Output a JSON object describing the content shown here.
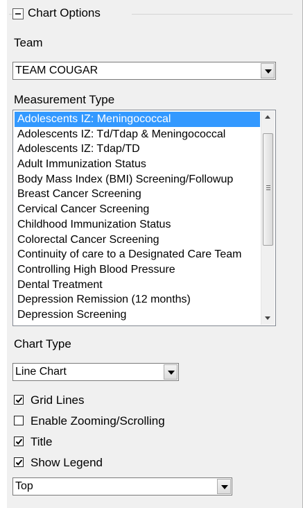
{
  "group": {
    "title": "Chart Options"
  },
  "team": {
    "label": "Team",
    "value": "TEAM COUGAR"
  },
  "measurement": {
    "label": "Measurement Type",
    "items": [
      "Adolescents IZ: Meningococcal",
      "Adolescents IZ: Td/Tdap & Meningococcal",
      "Adolescents IZ: Tdap/TD",
      "Adult Immunization Status",
      "Body Mass Index (BMI) Screening/Followup",
      "Breast Cancer Screening",
      "Cervical Cancer Screening",
      "Childhood Immunization Status",
      "Colorectal Cancer Screening",
      "Continuity of care to a Designated Care Team",
      "Controlling High Blood Pressure",
      "Dental Treatment",
      "Depression Remission (12 months)",
      "Depression Screening"
    ],
    "selected_index": 0
  },
  "chart_type": {
    "label": "Chart Type",
    "value": "Line Chart"
  },
  "options": {
    "grid_lines": {
      "label": "Grid Lines",
      "checked": true
    },
    "zoom": {
      "label": "Enable Zooming/Scrolling",
      "checked": false
    },
    "title": {
      "label": "Title",
      "checked": true
    },
    "legend": {
      "label": "Show Legend",
      "checked": true
    }
  },
  "legend_position": {
    "value": "Top"
  }
}
